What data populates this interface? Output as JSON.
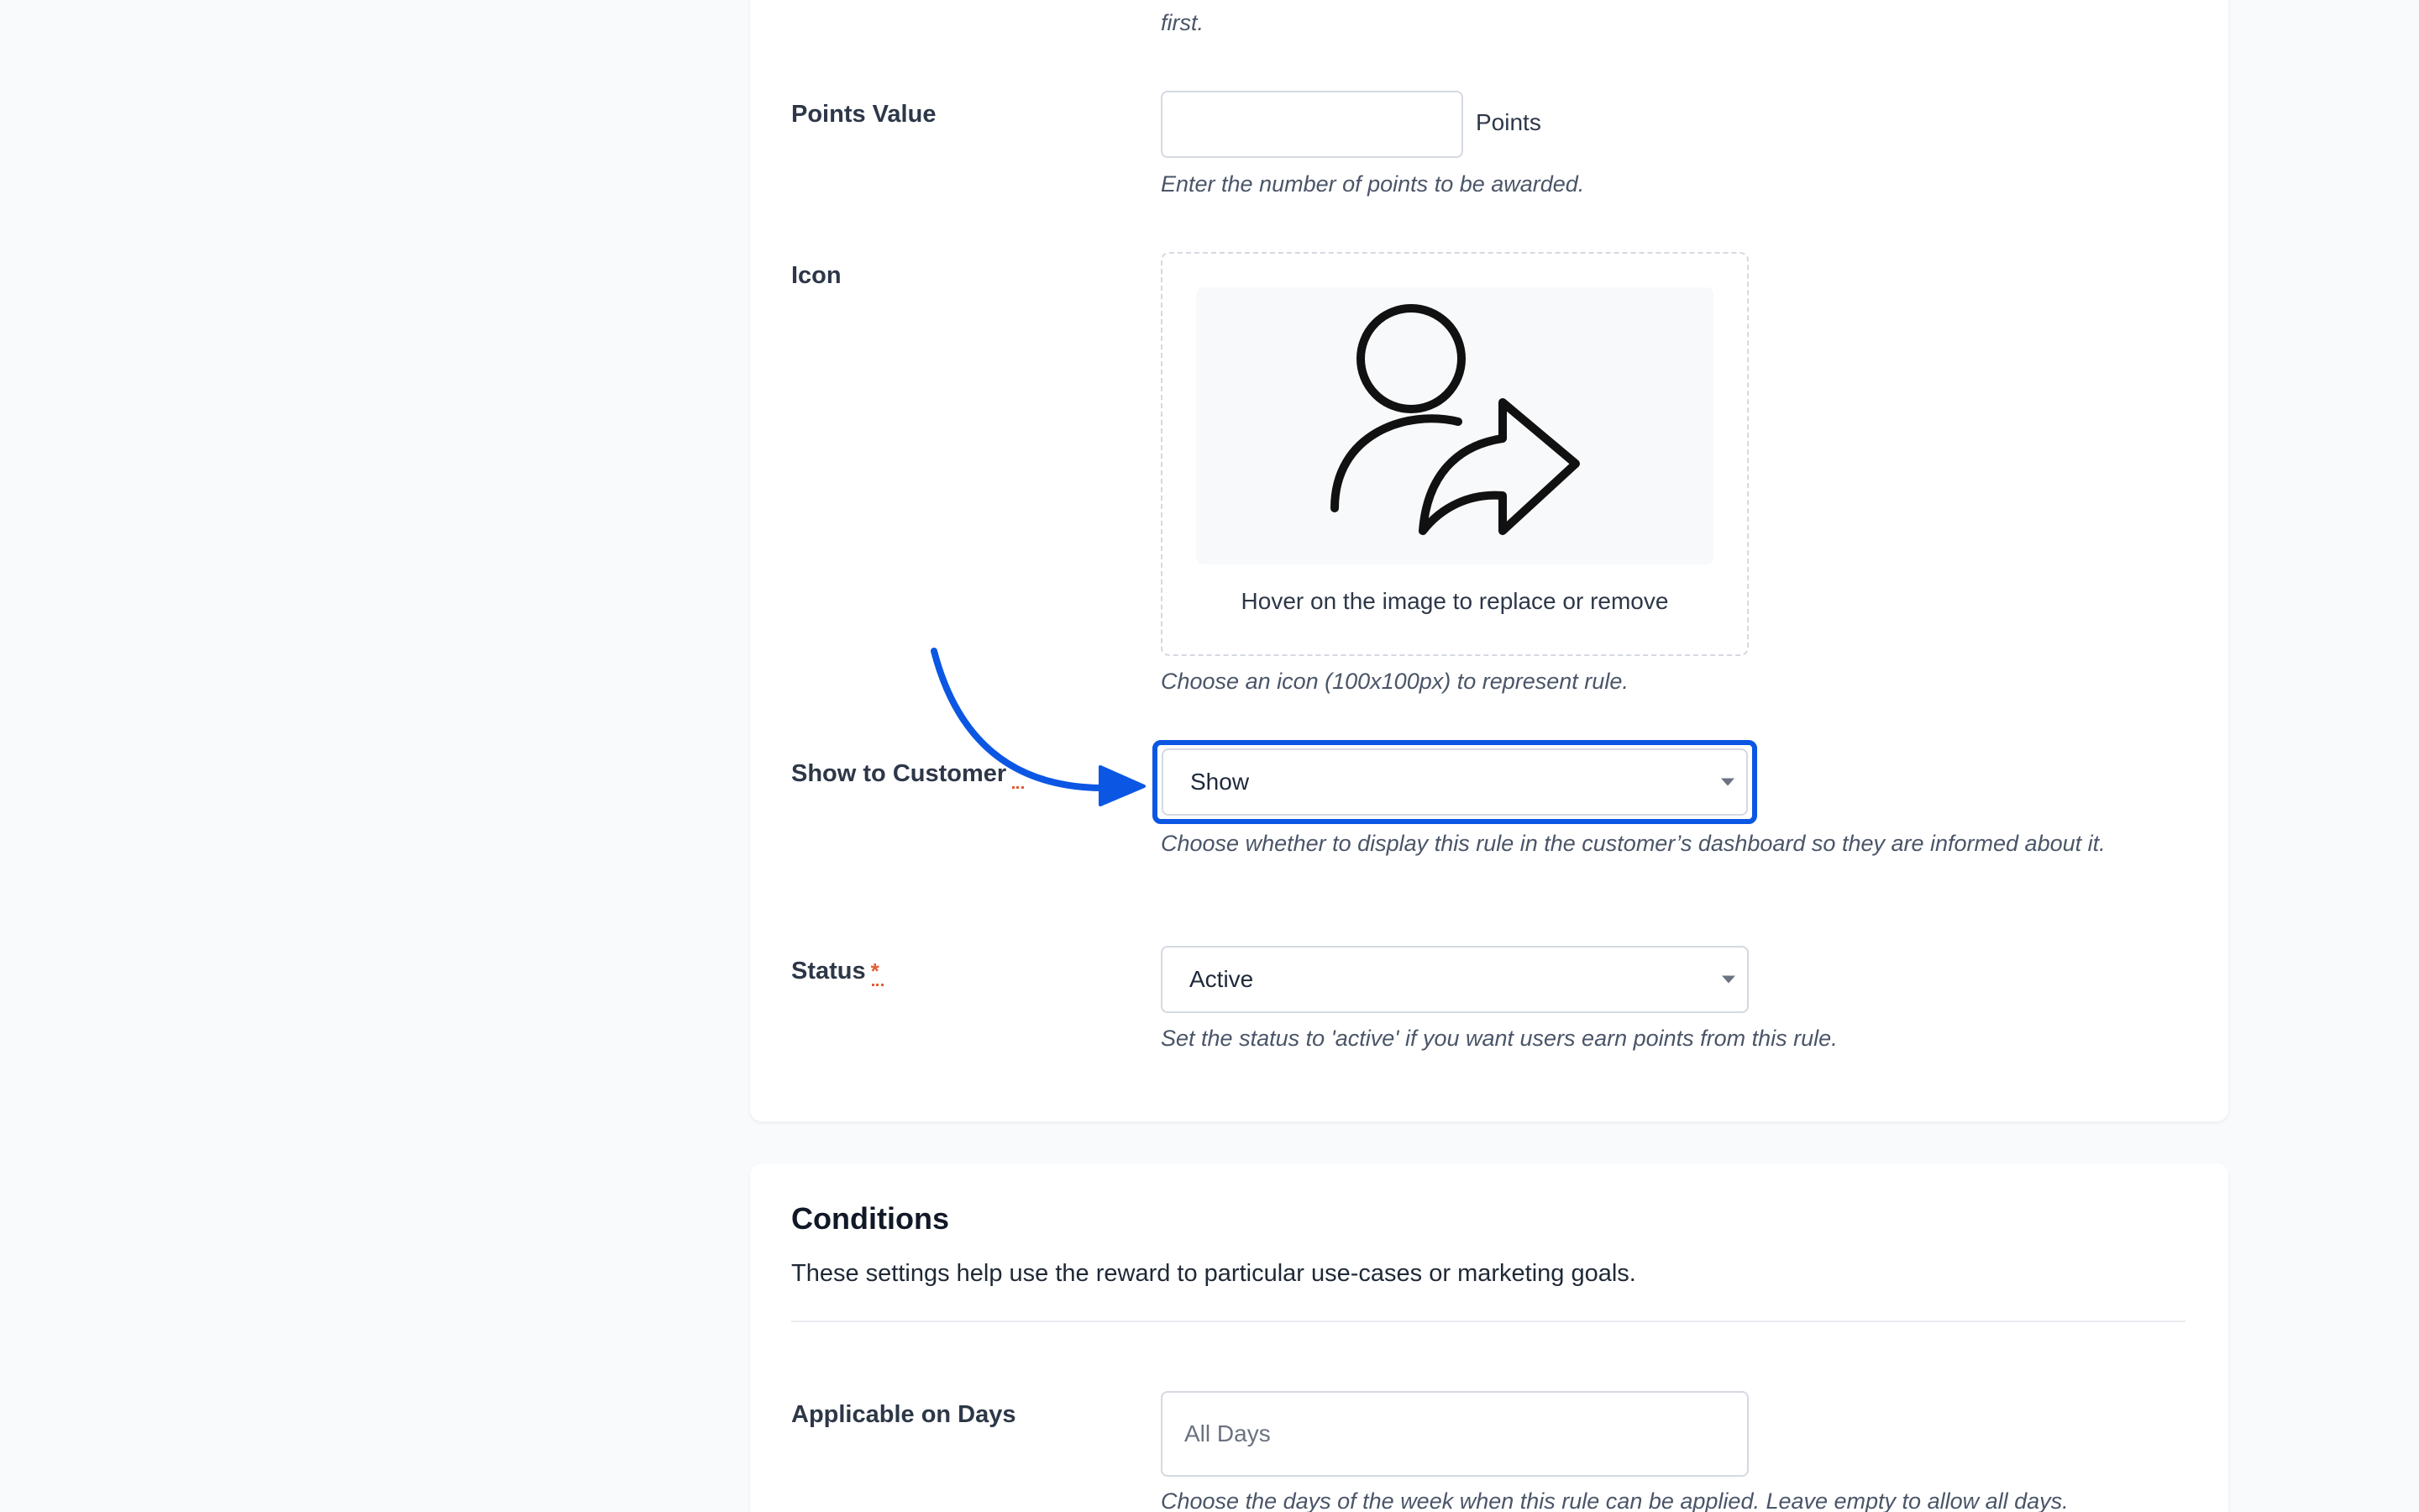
{
  "form": {
    "top_help_partial": "first.",
    "points_value": {
      "label": "Points Value",
      "value": "",
      "suffix": "Points",
      "help": "Enter the number of points to be awarded."
    },
    "icon": {
      "label": "Icon",
      "image_icon": "user-share-icon",
      "hint": "Hover on the image to replace or remove",
      "help": "Choose an icon (100x100px) to represent rule."
    },
    "show_to_customer": {
      "label": "Show to Customer",
      "required_mark": "*",
      "selected": "Show",
      "help": "Choose whether to display this rule in the customer’s dashboard so they are informed about it."
    },
    "status": {
      "label": "Status",
      "required_mark": "*",
      "selected": "Active",
      "help": "Set the status to 'active' if you want users earn points from this rule."
    }
  },
  "conditions": {
    "title": "Conditions",
    "description": "These settings help use the reward to particular use-cases or marketing goals.",
    "applicable_on_days": {
      "label": "Applicable on Days",
      "placeholder": "All Days",
      "help": "Choose the days of the week when this rule can be applied. Leave empty to allow all days."
    }
  },
  "colors": {
    "highlight": "#0b57e3",
    "required": "#e25d34",
    "card": "#ffffff",
    "page": "#f8fafc"
  }
}
